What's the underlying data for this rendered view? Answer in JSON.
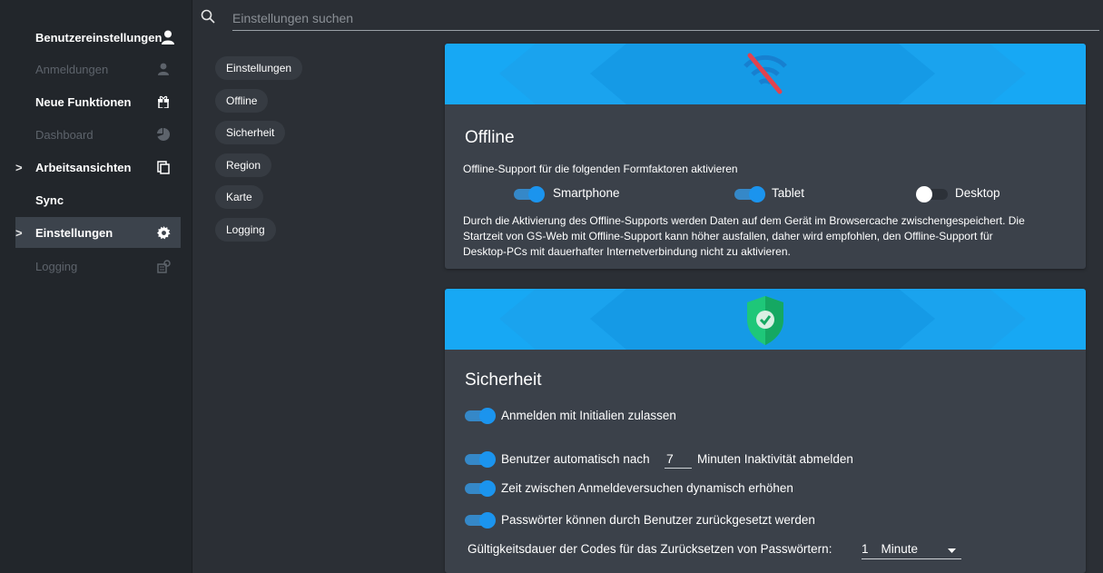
{
  "sidebar": {
    "items": [
      {
        "label": "Benutzereinstellungen",
        "icon": "user-icon"
      },
      {
        "label": "Anmeldungen",
        "icon": "user-icon"
      },
      {
        "label": "Neue Funktionen",
        "icon": "gift-icon"
      },
      {
        "label": "Dashboard",
        "icon": "pie-chart-icon"
      },
      {
        "label": "Arbeitsansichten",
        "icon": "copy-icon"
      },
      {
        "label": "Sync",
        "icon": ""
      },
      {
        "label": "Einstellungen",
        "icon": "gear-icon"
      },
      {
        "label": "Logging",
        "icon": "log-icon"
      }
    ],
    "chevron": ">"
  },
  "search": {
    "placeholder": "Einstellungen suchen"
  },
  "nav": {
    "chips": [
      "Einstellungen",
      "Offline",
      "Sicherheit",
      "Region",
      "Karte",
      "Logging"
    ]
  },
  "offline": {
    "title": "Offline",
    "intro": "Offline-Support für die folgenden Formfaktoren aktivieren",
    "toggles": [
      {
        "label": "Smartphone",
        "on": true
      },
      {
        "label": "Tablet",
        "on": true
      },
      {
        "label": "Desktop",
        "on": false
      }
    ],
    "desc_line1": "Durch die Aktivierung des Offline-Supports werden Daten auf dem Gerät im Browsercache zwischengespeichert. Die",
    "desc_line2": "Startzeit von GS-Web mit Offline-Support kann höher ausfallen, daher wird empfohlen, den Offline-Support für",
    "desc_line3": "Desktop-PCs mit dauerhafter Internetverbindung nicht zu aktivieren."
  },
  "security": {
    "title": "Sicherheit",
    "initials_label": "Anmelden mit Initialien zulassen",
    "auto_logout_prefix": "Benutzer automatisch nach",
    "auto_logout_value": "7",
    "auto_logout_suffix": "Minuten Inaktivität abmelden",
    "dynamic_label": "Zeit zwischen Anmeldeversuchen dynamisch erhöhen",
    "reset_label": "Passwörter können durch Benutzer zurückgesetzt werden",
    "validity_label": "Gültigkeitsdauer der Codes für das Zurücksetzen von Passwörtern:",
    "validity_value": "1",
    "validity_unit": "Minute"
  },
  "colors": {
    "accent": "#1b94ee",
    "banner": "#17a8f4",
    "card": "#3b414a",
    "background": "#2b2f35",
    "sidebar": "#22262b"
  }
}
